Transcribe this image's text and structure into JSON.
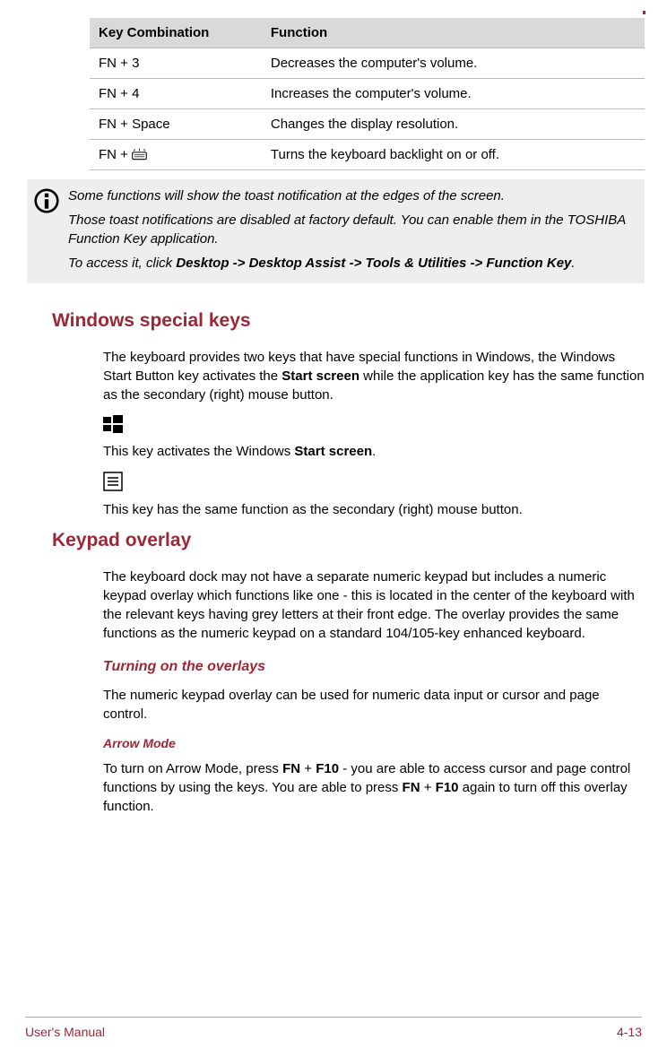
{
  "table": {
    "headers": [
      "Key Combination",
      "Function"
    ],
    "rows": [
      {
        "key": "FN + 3",
        "fn": "Decreases the computer's volume."
      },
      {
        "key": "FN + 4",
        "fn": "Increases the computer's volume."
      },
      {
        "key": "FN + Space",
        "fn": "Changes the display resolution."
      },
      {
        "key": "FN + ",
        "fn": "Turns the keyboard backlight on or off."
      }
    ]
  },
  "info": {
    "p1": "Some functions will show the toast notification at the edges of the screen.",
    "p2": "Those toast notifications are disabled at factory default. You can enable them in the TOSHIBA Function Key application.",
    "p3a": "To access it, click ",
    "p3b": "Desktop -> Desktop Assist -> Tools & Utilities -> Function Key",
    "p3c": "."
  },
  "sections": {
    "winkeys": {
      "heading": "Windows special keys",
      "p1a": "The keyboard provides two keys that have special functions in Windows, the Windows Start Button key activates the ",
      "p1b": "Start screen",
      "p1c": " while the application key has the same function as the secondary (right) mouse button.",
      "p2a": "This key activates the Windows ",
      "p2b": "Start screen",
      "p2c": ".",
      "p3": "This key has the same function as the secondary (right) mouse button."
    },
    "keypad": {
      "heading": "Keypad overlay",
      "p1": "The keyboard dock may not have a separate numeric keypad but includes a numeric keypad overlay which functions like one - this is located in the center of the keyboard with the relevant keys having grey letters at their front edge. The overlay provides the same functions as the numeric keypad on a standard 104/105-key enhanced keyboard.",
      "sub1": {
        "heading": "Turning on the overlays",
        "p1": "The numeric keypad overlay can be used for numeric data input or cursor and page control."
      },
      "sub2": {
        "heading": "Arrow Mode",
        "p1a": "To turn on Arrow Mode, press ",
        "p1b": "FN",
        "p1c": " + ",
        "p1d": "F10",
        "p1e": " - you are able to access cursor and page control functions by using the keys. You are able to press ",
        "p1f": "FN",
        "p1g": " + ",
        "p1h": "F10",
        "p1i": " again to turn off this overlay function."
      }
    }
  },
  "footer": {
    "left": "User's Manual",
    "right": "4-13"
  }
}
